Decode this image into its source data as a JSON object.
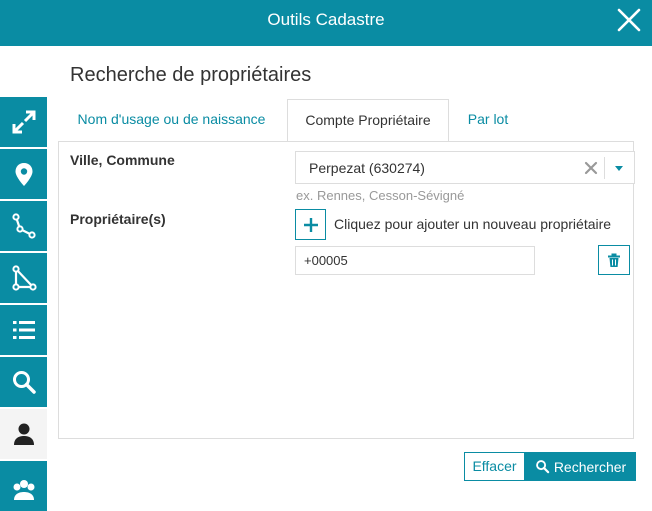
{
  "window": {
    "title": "Outils Cadastre"
  },
  "colors": {
    "accent": "#0a8ca3",
    "active_sidebar": "#f4f4f4"
  },
  "sidebar": {
    "items": [
      {
        "icon": "expand-arrows-icon"
      },
      {
        "icon": "map-pin-icon"
      },
      {
        "icon": "line-draw-icon"
      },
      {
        "icon": "polygon-draw-icon"
      },
      {
        "icon": "list-icon"
      },
      {
        "icon": "search-icon"
      },
      {
        "icon": "person-icon",
        "active": true
      },
      {
        "icon": "group-icon"
      }
    ]
  },
  "panel": {
    "title": "Recherche de propriétaires"
  },
  "tabs": [
    {
      "label": "Nom d'usage ou de naissance"
    },
    {
      "label": "Compte Propriétaire",
      "active": true
    },
    {
      "label": "Par lot"
    }
  ],
  "form": {
    "commune_label": "Ville, Commune",
    "commune_value": "Perpezat (630274)",
    "commune_hint": "ex. Rennes, Cesson-Sévigné",
    "owners_label": "Propriétaire(s)",
    "add_owner_label": "Cliquez pour ajouter un nouveau propriétaire",
    "owner_value": "+00005"
  },
  "actions": {
    "clear_label": "Effacer",
    "search_label": "Rechercher"
  }
}
